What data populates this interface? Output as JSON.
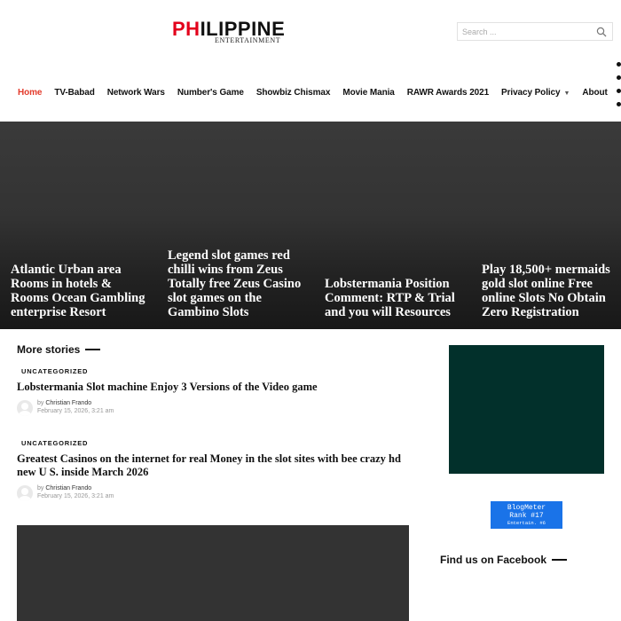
{
  "site": {
    "logo_red": "PH",
    "logo_dark": "ILIPPINE",
    "logo_sub": "ENTERTAINMENT",
    "brand_red": "#e3001b"
  },
  "search": {
    "placeholder": "Search ...",
    "icon": "search-icon"
  },
  "nav": {
    "items": [
      {
        "label": "Home",
        "active": true
      },
      {
        "label": "TV-Babad"
      },
      {
        "label": "Network Wars"
      },
      {
        "label": "Number's Game"
      },
      {
        "label": "Showbiz Chismax"
      },
      {
        "label": "Movie Mania"
      },
      {
        "label": "RAWR Awards 2021"
      },
      {
        "label": "Privacy Policy",
        "has_dropdown": true
      },
      {
        "label": "About"
      }
    ],
    "active_color": "#e33b2c"
  },
  "hero": {
    "tiles": [
      {
        "title": "Atlantic Urban area Rooms in hotels & Rooms Ocean Gambling enterprise Resort"
      },
      {
        "title": "Legend slot games red chilli wins from Zeus Totally free Zeus Casino slot games on the Gambino Slots"
      },
      {
        "title": "Lobstermania Position Comment: RTP & Trial and you will Resources"
      },
      {
        "title": "Play 18,500+ mermaids gold slot online Free online Slots No Obtain Zero Registration"
      }
    ]
  },
  "more_stories": {
    "heading": "More stories",
    "stories": [
      {
        "category": "UNCATEGORIZED",
        "title": "Lobstermania Slot machine Enjoy 3 Versions of the Video game",
        "by": "by",
        "author": "Christian Frando",
        "date": "February 15, 2026, 3:21 am"
      },
      {
        "category": "UNCATEGORIZED",
        "title": "Greatest Casinos on the internet for real Money in the slot sites with bee crazy hd new U S. inside March 2026",
        "by": "by",
        "author": "Christian Frando",
        "date": "February 15, 2026, 3:21 am"
      }
    ]
  },
  "sidebar": {
    "ad_color": "#02302b",
    "blogmeter": {
      "line1": "BlogMeter",
      "line2": "Rank #17",
      "line3": "Entertain. #6"
    },
    "facebook_heading": "Find us on Facebook"
  }
}
